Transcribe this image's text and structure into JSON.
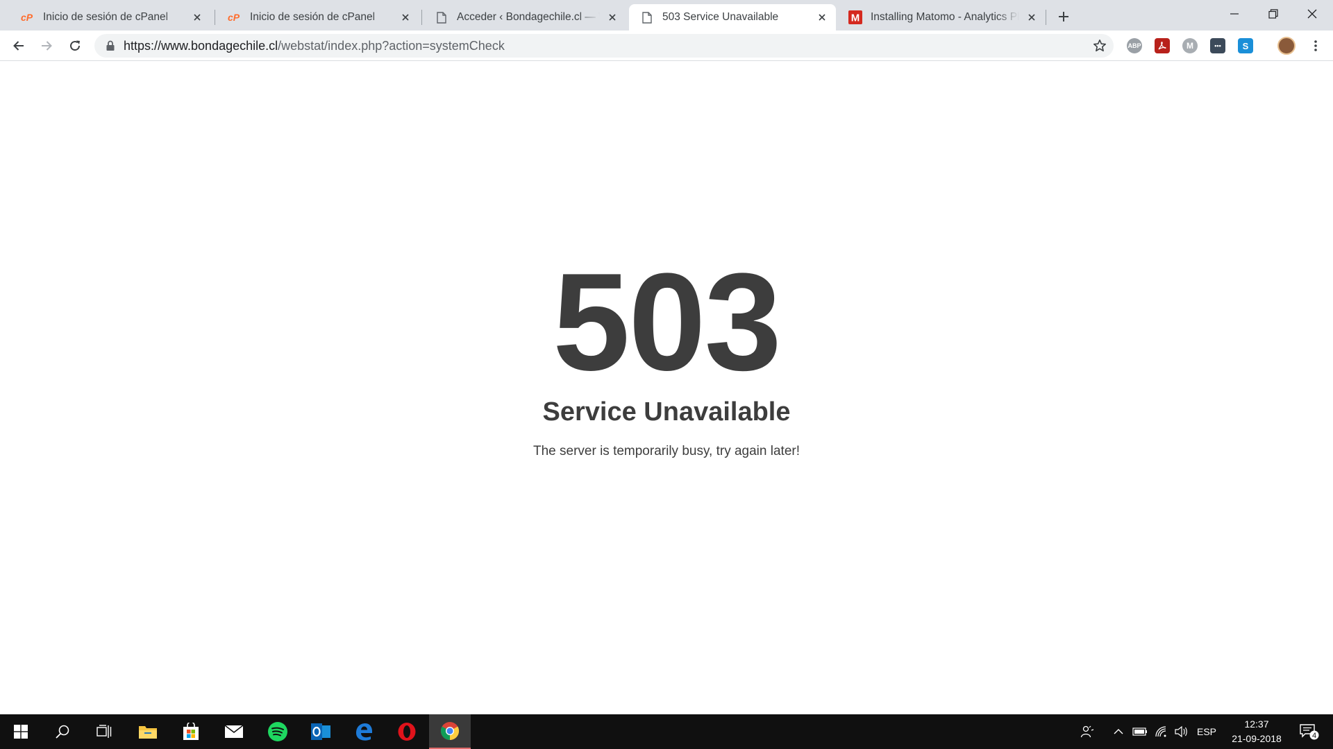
{
  "browser": {
    "tabs": [
      {
        "title": "Inicio de sesión de cPanel",
        "favicon": "cpanel-icon",
        "active": false
      },
      {
        "title": "Inicio de sesión de cPanel",
        "favicon": "cpanel-icon",
        "active": false
      },
      {
        "title": "Acceder ‹ Bondagechile.cl — WordPress",
        "favicon": "page-icon",
        "active": false
      },
      {
        "title": "503 Service Unavailable",
        "favicon": "page-icon",
        "active": true
      },
      {
        "title": "Installing Matomo - Analytics Platform",
        "favicon": "matomo-icon",
        "active": false
      }
    ],
    "url": {
      "host": "https://www.bondagechile.cl",
      "path": "/webstat/index.php?action=systemCheck"
    },
    "extensions": [
      "abp-icon",
      "acrobat-icon",
      "metamask-icon",
      "password-manager-icon",
      "skype-icon"
    ]
  },
  "page": {
    "code": "503",
    "heading": "Service Unavailable",
    "message": "The server is temporarily busy, try again later!"
  },
  "taskbar": {
    "apps": [
      "start-icon",
      "search-icon",
      "task-view-icon",
      "file-explorer-icon",
      "store-icon",
      "mail-icon",
      "spotify-icon",
      "outlook-icon",
      "edge-icon",
      "opera-icon",
      "chrome-icon"
    ],
    "tray": {
      "language": "ESP",
      "time": "12:37",
      "date": "21-09-2018",
      "notifications": "4"
    }
  },
  "colors": {
    "text": "#3d3d3d",
    "tabstrip": "#dee1e6",
    "taskbar": "#101010",
    "cpanel": "#ff6c2c",
    "matomo": "#d4291f"
  }
}
